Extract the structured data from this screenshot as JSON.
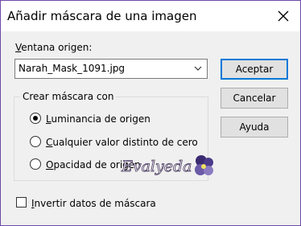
{
  "window": {
    "title": "Añadir máscara de una imagen"
  },
  "source": {
    "label_underlined": "V",
    "label_rest": "entana origen:",
    "selected_value": "Narah_Mask_1091.jpg"
  },
  "buttons": {
    "accept": "Aceptar",
    "cancel": "Cancelar",
    "help": "Ayuda"
  },
  "mask_group": {
    "legend": "Crear máscara con",
    "options": [
      {
        "u": "L",
        "rest": "uminancia de origen",
        "checked": true
      },
      {
        "u": "C",
        "rest": "ualquier valor distinto de cero",
        "checked": false
      },
      {
        "u": "O",
        "rest": "pacidad de origen",
        "checked": false
      }
    ]
  },
  "invert": {
    "u": "I",
    "rest": "nvertir datos de máscara",
    "checked": false
  },
  "watermark": {
    "text": "Evalyeda"
  },
  "colors": {
    "accent": "#0078d7",
    "frame": "#6e4aa8"
  }
}
